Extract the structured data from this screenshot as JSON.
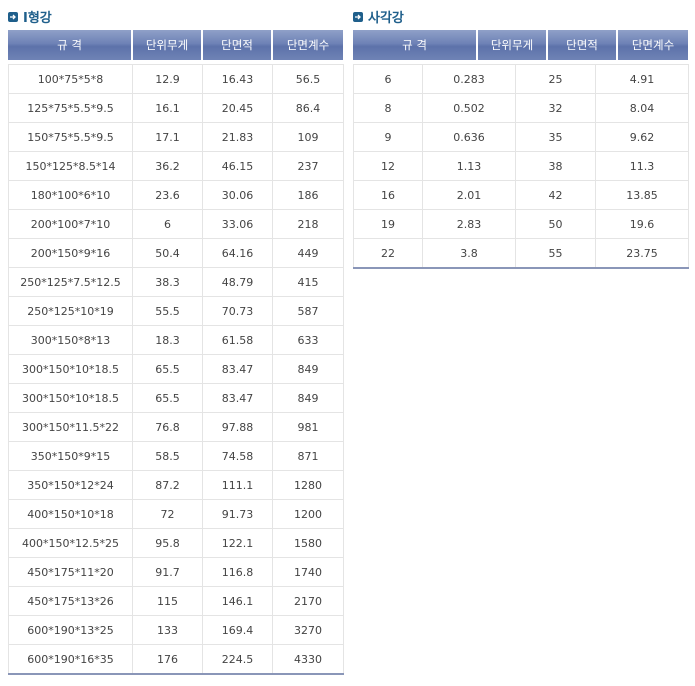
{
  "left": {
    "title": "I형강",
    "headers": [
      "규 격",
      "단위무게",
      "단면적",
      "단면계수"
    ],
    "rows": [
      [
        "100*75*5*8",
        "12.9",
        "16.43",
        "56.5"
      ],
      [
        "125*75*5.5*9.5",
        "16.1",
        "20.45",
        "86.4"
      ],
      [
        "150*75*5.5*9.5",
        "17.1",
        "21.83",
        "109"
      ],
      [
        "150*125*8.5*14",
        "36.2",
        "46.15",
        "237"
      ],
      [
        "180*100*6*10",
        "23.6",
        "30.06",
        "186"
      ],
      [
        "200*100*7*10",
        "6",
        "33.06",
        "218"
      ],
      [
        "200*150*9*16",
        "50.4",
        "64.16",
        "449"
      ],
      [
        "250*125*7.5*12.5",
        "38.3",
        "48.79",
        "415"
      ],
      [
        "250*125*10*19",
        "55.5",
        "70.73",
        "587"
      ],
      [
        "300*150*8*13",
        "18.3",
        "61.58",
        "633"
      ],
      [
        "300*150*10*18.5",
        "65.5",
        "83.47",
        "849"
      ],
      [
        "300*150*10*18.5",
        "65.5",
        "83.47",
        "849"
      ],
      [
        "300*150*11.5*22",
        "76.8",
        "97.88",
        "981"
      ],
      [
        "350*150*9*15",
        "58.5",
        "74.58",
        "871"
      ],
      [
        "350*150*12*24",
        "87.2",
        "111.1",
        "1280"
      ],
      [
        "400*150*10*18",
        "72",
        "91.73",
        "1200"
      ],
      [
        "400*150*12.5*25",
        "95.8",
        "122.1",
        "1580"
      ],
      [
        "450*175*11*20",
        "91.7",
        "116.8",
        "1740"
      ],
      [
        "450*175*13*26",
        "115",
        "146.1",
        "2170"
      ],
      [
        "600*190*13*25",
        "133",
        "169.4",
        "3270"
      ],
      [
        "600*190*16*35",
        "176",
        "224.5",
        "4330"
      ]
    ]
  },
  "right": {
    "title": "사각강",
    "headers": [
      "규 격",
      "단위무게",
      "단면적",
      "단면계수"
    ],
    "rows": [
      [
        "6",
        "0.283",
        "25",
        "4.91"
      ],
      [
        "8",
        "0.502",
        "32",
        "8.04"
      ],
      [
        "9",
        "0.636",
        "35",
        "9.62"
      ],
      [
        "12",
        "1.13",
        "38",
        "11.3"
      ],
      [
        "16",
        "2.01",
        "42",
        "13.85"
      ],
      [
        "19",
        "2.83",
        "50",
        "19.6"
      ],
      [
        "22",
        "3.8",
        "55",
        "23.75"
      ]
    ]
  },
  "colors": {
    "title": "#1f5f8b",
    "header_bg": "#6e82b6",
    "header_text": "#ffffff",
    "grid": "#e4e4e4",
    "bottom_rule": "#8a96b8"
  }
}
